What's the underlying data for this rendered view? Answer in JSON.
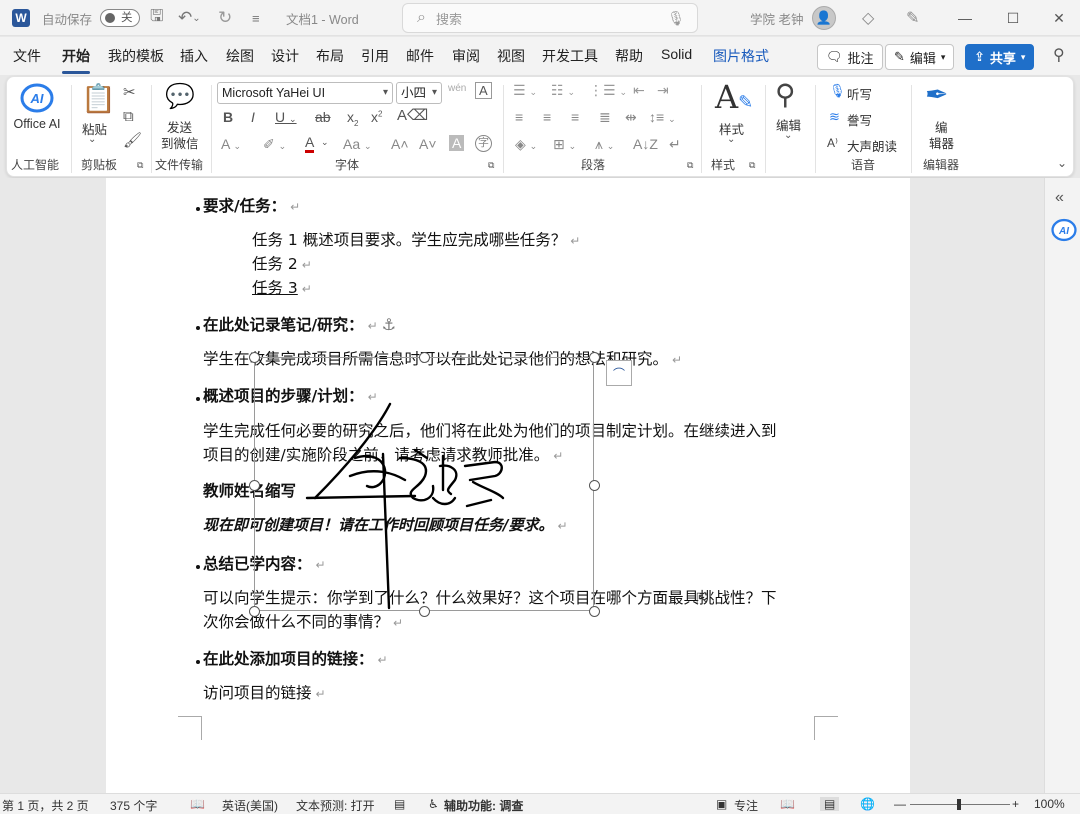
{
  "titlebar": {
    "autosave_label": "自动保存",
    "autosave_state": "关",
    "doc_title": "文档1 - Word",
    "search_placeholder": "搜索",
    "user_name": "学院 老钟"
  },
  "tabs": [
    "文件",
    "开始",
    "我的模板",
    "插入",
    "绘图",
    "设计",
    "布局",
    "引用",
    "邮件",
    "审阅",
    "视图",
    "开发工具",
    "帮助",
    "Solid",
    "图片格式"
  ],
  "active_tab": "开始",
  "top_buttons": {
    "comments": "批注",
    "editing": "编辑",
    "share": "共享"
  },
  "ribbon": {
    "office_ai": "Office AI",
    "ai_group": "人工智能",
    "paste": "粘贴",
    "clipboard_group": "剪贴板",
    "send_wechat_line1": "发送",
    "send_wechat_line2": "到微信",
    "file_transfer_group": "文件传输",
    "font_name": "Microsoft YaHei UI",
    "font_size": "小四",
    "font_group": "字体",
    "paragraph_group": "段落",
    "styles_label": "样式",
    "styles_group": "样式",
    "edit_label": "编辑",
    "dictate": "听写",
    "read_aloud": "誊写",
    "read_loud": "大声朗读",
    "voice_group": "语音",
    "editor_label_1": "编",
    "editor_label_2": "辑器",
    "editor_group": "编辑器"
  },
  "document": {
    "h1": "要求/任务：",
    "task1": "任务 1 概述项目要求。学生应完成哪些任务？",
    "task2": "任务 2",
    "task3": "任务 3",
    "h2": "在此处记录笔记/研究：",
    "p2": "学生在收集完成项目所需信息时可以在此处记录他们的想法和研究。",
    "h3": "概述项目的步骤/计划：",
    "p3_line1": "学生完成任何必要的研究之后，他们将在此处为他们的项目制定计划。在继续进入到",
    "p3_line2": "项目的创建/实施阶段之前，请考虑请求教师批准。",
    "teacher_sign": "教师姓名缩写",
    "italic_line": "现在即可创建项目！请在工作时回顾项目任务/要求。",
    "h4": "总结已学内容：",
    "p4_line1": "可以向学生提示：你学到了什么？什么效果好？这个项目在哪个方面最具挑战性？下",
    "p4_line2": "次你会做什么不同的事情？",
    "h5": "在此处添加项目的链接：",
    "p5": "访问项目的链接",
    "para_mark": "↵"
  },
  "statusbar": {
    "page": "第 1 页，共 2 页",
    "words": "375 个字",
    "lang": "英语(美国)",
    "predict": "文本预测: 打开",
    "access": "辅助功能: 调查",
    "focus": "专注",
    "zoom": "100%"
  },
  "colors": {
    "accent": "#2b579a",
    "share": "#1f6fc9",
    "ai": "#2b7de9"
  }
}
